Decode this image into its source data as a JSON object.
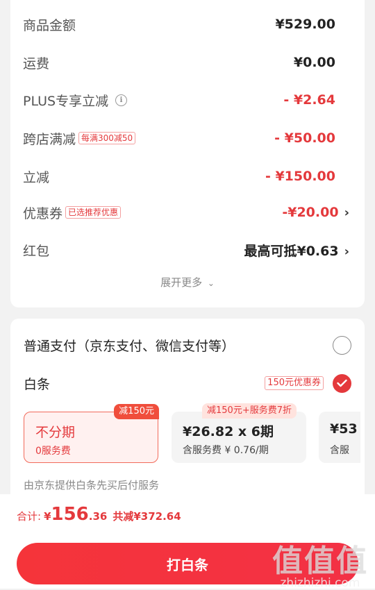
{
  "price_rows": [
    {
      "label": "商品金额",
      "value": "¥529.00",
      "color": "dark"
    },
    {
      "label": "运费",
      "value": "¥0.00",
      "color": "dark"
    },
    {
      "label": "PLUS专享立减",
      "value": "- ¥2.64",
      "color": "red"
    },
    {
      "label": "跨店满减",
      "tag": "每满300减50",
      "value": "- ¥50.00",
      "color": "red"
    },
    {
      "label": "立减",
      "value": "- ¥150.00",
      "color": "red"
    },
    {
      "label": "优惠券",
      "tag": "已选推荐优惠",
      "value": "-¥20.00",
      "color": "red"
    },
    {
      "label": "红包",
      "value": "最高可抵¥0.63",
      "color": "dark"
    }
  ],
  "expand_more": "展开更多",
  "payment": {
    "normal_label": "普通支付（京东支付、微信支付等）",
    "baitiao_label": "白条",
    "baitiao_coupon": "150元优惠券",
    "plans": [
      {
        "main": "不分期",
        "sub": "0服务费",
        "badge": "减150元"
      },
      {
        "main": "¥26.82 x 6期",
        "sub": "含服务费 ¥ 0.76/期",
        "badge": "减150元+服务费7折"
      },
      {
        "main": "¥53",
        "sub": "含服"
      }
    ],
    "provider_note": "由京东提供白条先买后付服务"
  },
  "summary": {
    "total_label": "合计:",
    "currency": "¥",
    "total_int": "156",
    "total_dec": ".36",
    "saved": "共减¥372.64",
    "button": "打白条"
  },
  "watermark": {
    "big": "值值值",
    "small": "zhizhizhi.com"
  },
  "colors": {
    "accent": "#e4393c",
    "button": "#f5343a"
  }
}
